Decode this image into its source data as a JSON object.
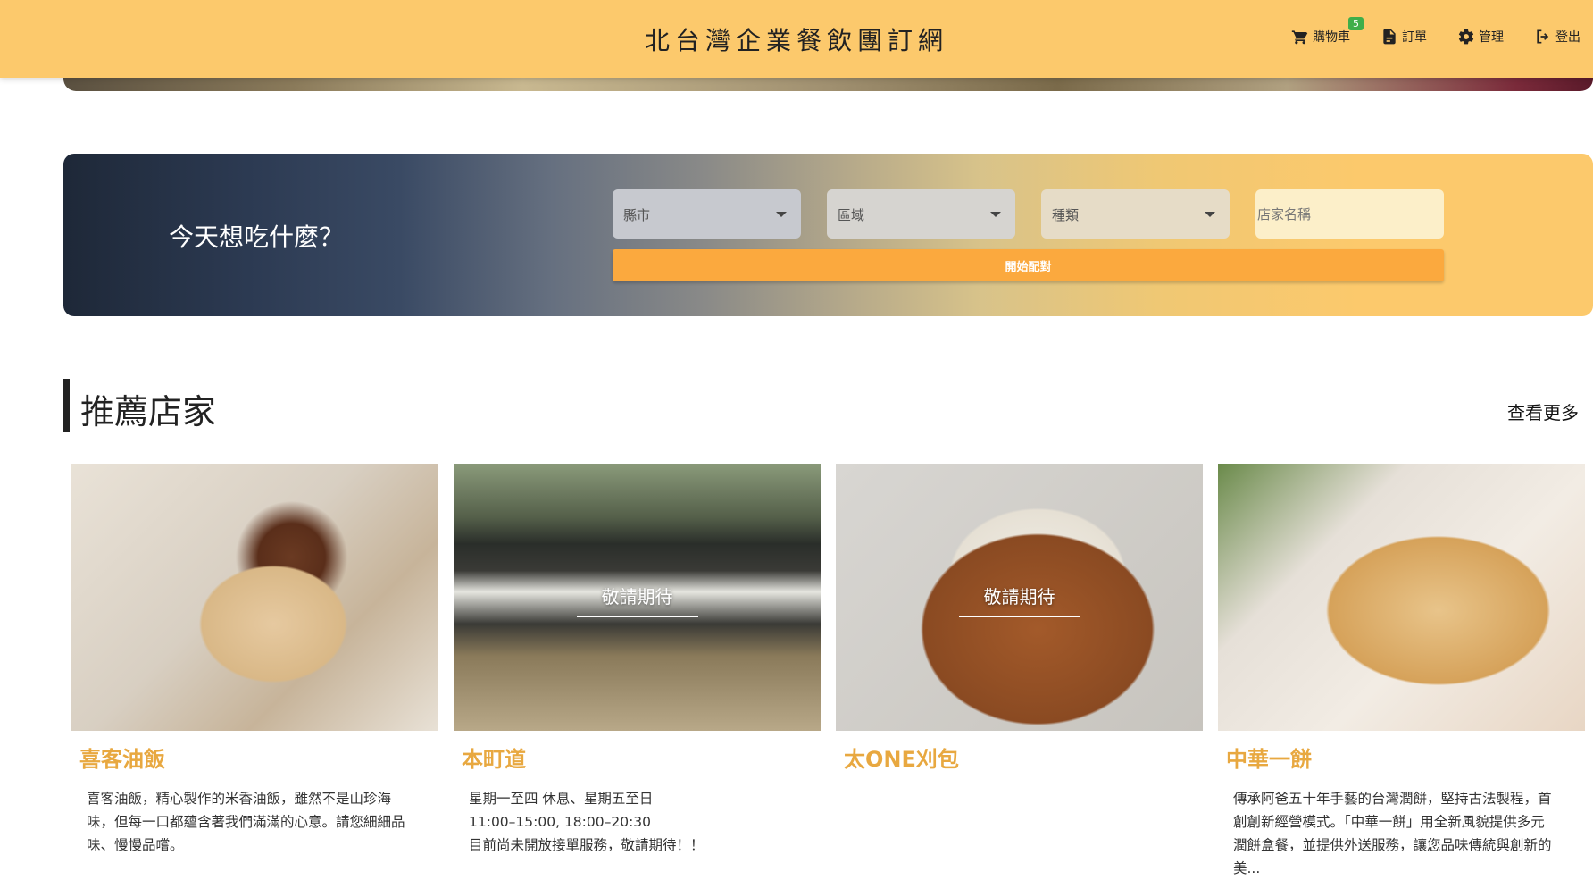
{
  "header": {
    "brand": "北台灣企業餐飲團訂網",
    "nav": {
      "cart_label": "購物車",
      "cart_count": "5",
      "orders_label": "訂單",
      "admin_label": "管理",
      "logout_label": "登出"
    }
  },
  "search": {
    "title": "今天想吃什麼？",
    "city_placeholder": "縣市",
    "district_placeholder": "區域",
    "category_placeholder": "種類",
    "store_name_placeholder": "店家名稱",
    "match_button": "開始配對"
  },
  "recommended": {
    "title": "推薦店家",
    "see_more": "查看更多",
    "cards": [
      {
        "name": "喜客油飯",
        "overlay": "",
        "description": "喜客油飯，精心製作的米香油飯，雖然不是山珍海\n味，但每一口都蘊含著我們滿滿的心意。請您細細品\n味、慢慢品嚐。"
      },
      {
        "name": "本町道",
        "overlay": "敬請期待",
        "description": "星期一至四 休息、星期五至日\n11:00–15:00, 18:00–20:30\n目前尚未開放接單服務，敬請期待！！"
      },
      {
        "name": "太ONE刈包",
        "overlay": "敬請期待",
        "description": ""
      },
      {
        "name": "中華一餅",
        "overlay": "",
        "description": "傳承阿爸五十年手藝的台灣潤餅，堅持古法製程，首\n創創新經營模式。「中華一餅」用全新風貌提供多元\n潤餅盒餐，並提供外送服務，讓您品味傳統與創新的\n美..."
      }
    ]
  },
  "colors": {
    "header_bg": "#fcc96c",
    "button_orange": "#fba93e",
    "store_name": "#e8a840",
    "badge_green": "#3fae4a"
  }
}
